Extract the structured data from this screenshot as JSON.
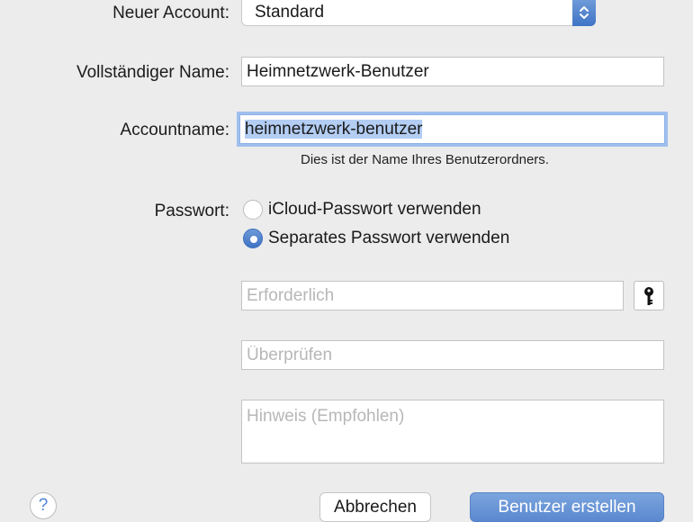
{
  "form": {
    "new_account_label": "Neuer Account:",
    "account_type_value": "Standard",
    "full_name_label": "Vollständiger Name:",
    "full_name_value": "Heimnetzwerk-Benutzer",
    "account_name_label": "Accountname:",
    "account_name_value": "heimnetzwerk-benutzer",
    "account_name_hint": "Dies ist der Name Ihres Benutzerordners.",
    "password_label": "Passwort:",
    "password_options": [
      {
        "label": "iCloud-Passwort verwenden",
        "selected": false
      },
      {
        "label": "Separates Passwort verwenden",
        "selected": true
      }
    ],
    "password_placeholder": "Erforderlich",
    "verify_placeholder": "Überprüfen",
    "hint_placeholder": "Hinweis (Empfohlen)"
  },
  "buttons": {
    "help": "?",
    "cancel": "Abbrechen",
    "create": "Benutzer erstellen"
  },
  "icons": {
    "stepper": "chevron-up-down-icon",
    "key": "key-icon"
  },
  "colors": {
    "accent": "#4a7fcf",
    "background": "#ececec",
    "selection": "#b3cdf3"
  }
}
